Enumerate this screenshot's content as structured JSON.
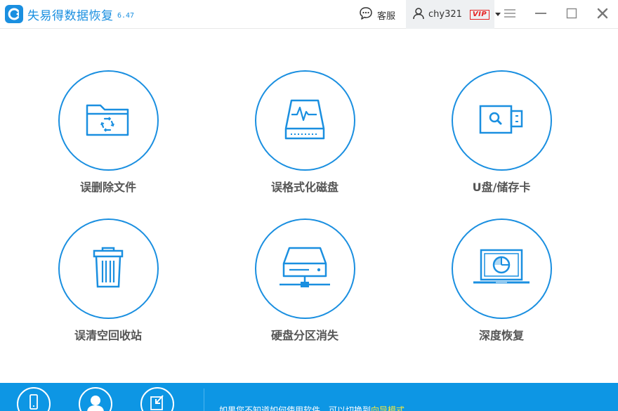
{
  "app": {
    "name": "失易得数据恢复",
    "version": "6.47",
    "brand_color": "#1a8fe0"
  },
  "header": {
    "support_label": "客服",
    "user_name": "chy321",
    "vip_label": "VIP",
    "icons": [
      "chat-icon",
      "user-icon",
      "menu-icon",
      "minimize-icon",
      "maximize-icon",
      "close-icon"
    ]
  },
  "tiles": [
    {
      "label": "误删除文件",
      "icon": "folder-recycle-icon"
    },
    {
      "label": "误格式化磁盘",
      "icon": "disk-pulse-icon"
    },
    {
      "label": "U盘/储存卡",
      "icon": "usb-drive-icon"
    },
    {
      "label": "误清空回收站",
      "icon": "recycle-bin-icon"
    },
    {
      "label": "硬盘分区消失",
      "icon": "network-drive-icon"
    },
    {
      "label": "深度恢复",
      "icon": "laptop-scan-icon"
    }
  ],
  "footer": {
    "icons": [
      "phone-recovery-icon",
      "customer-service-icon",
      "export-icon"
    ],
    "hint_text": "如果您不知道如何使用软件，可以切换到",
    "hint_link": "向导模式",
    "bar_color": "#0d96e4"
  }
}
